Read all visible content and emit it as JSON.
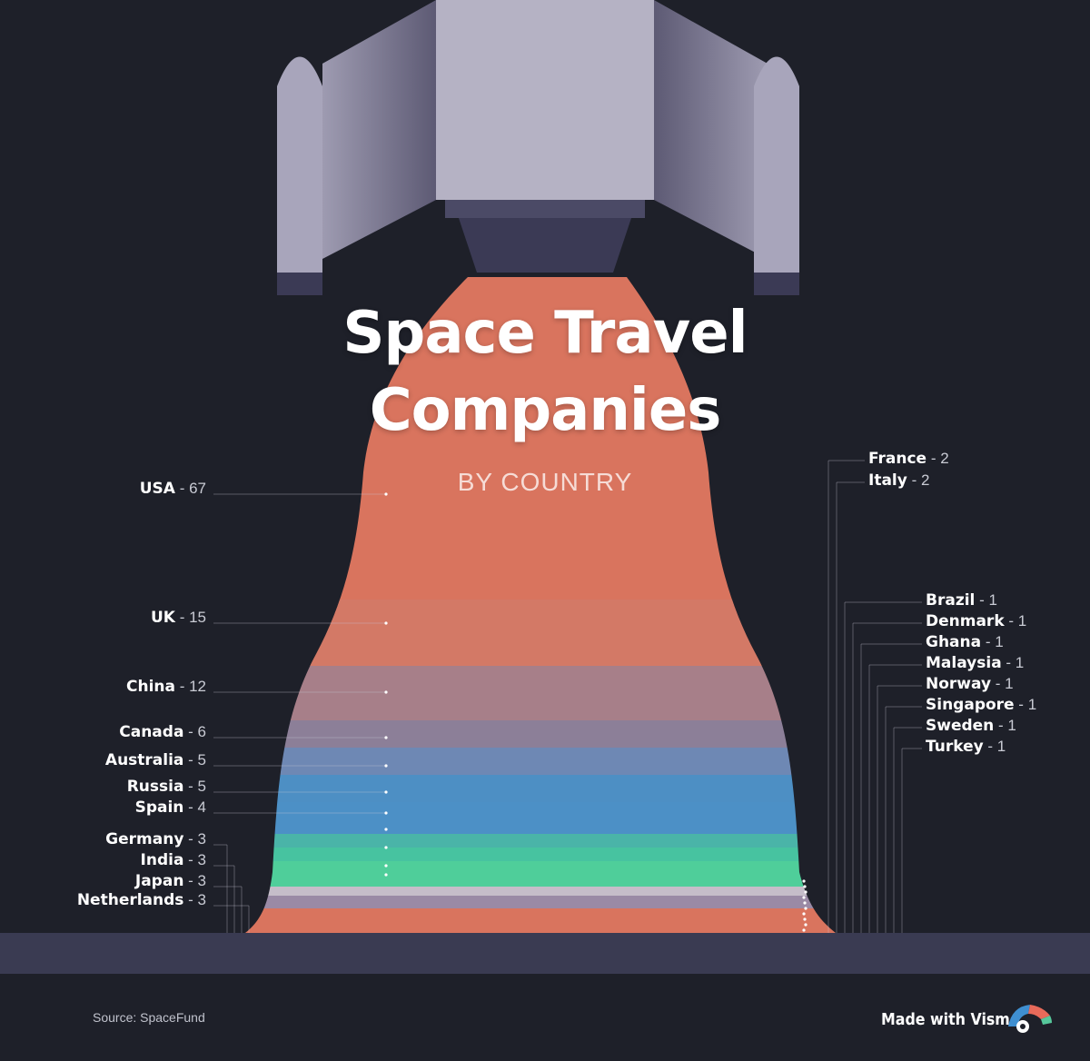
{
  "title_line1": "Space Travel",
  "title_line2": "Companies",
  "subtitle": "BY COUNTRY",
  "source": "Source: SpaceFund",
  "made_with": "Made with Visme",
  "icons": {
    "logo": "visme-logo-icon",
    "rocket": "rocket-illustration"
  },
  "colors": {
    "background": "#1e2029",
    "ground": "#3a3b52",
    "exhaust_orange": "#d9745e",
    "band_mauve": "#8f7d8e",
    "band_blue": "#4d8fc4",
    "band_green": "#4fce9a",
    "rocket_body": "#b5b2c4"
  },
  "chart_data": {
    "type": "area",
    "title": "Space Travel Companies",
    "subtitle": "BY COUNTRY",
    "series_left": [
      {
        "country": "USA",
        "value": 67
      },
      {
        "country": "UK",
        "value": 15
      },
      {
        "country": "China",
        "value": 12
      },
      {
        "country": "Canada",
        "value": 6
      },
      {
        "country": "Australia",
        "value": 5
      },
      {
        "country": "Russia",
        "value": 5
      },
      {
        "country": "Spain",
        "value": 4
      },
      {
        "country": "Germany",
        "value": 3
      },
      {
        "country": "India",
        "value": 3
      },
      {
        "country": "Japan",
        "value": 3
      },
      {
        "country": "Netherlands",
        "value": 3
      }
    ],
    "series_right": [
      {
        "country": "France",
        "value": 2
      },
      {
        "country": "Italy",
        "value": 2
      },
      {
        "country": "Brazil",
        "value": 1
      },
      {
        "country": "Denmark",
        "value": 1
      },
      {
        "country": "Ghana",
        "value": 1
      },
      {
        "country": "Malaysia",
        "value": 1
      },
      {
        "country": "Norway",
        "value": 1
      },
      {
        "country": "Singapore",
        "value": 1
      },
      {
        "country": "Sweden",
        "value": 1
      },
      {
        "country": "Turkey",
        "value": 1
      }
    ]
  }
}
